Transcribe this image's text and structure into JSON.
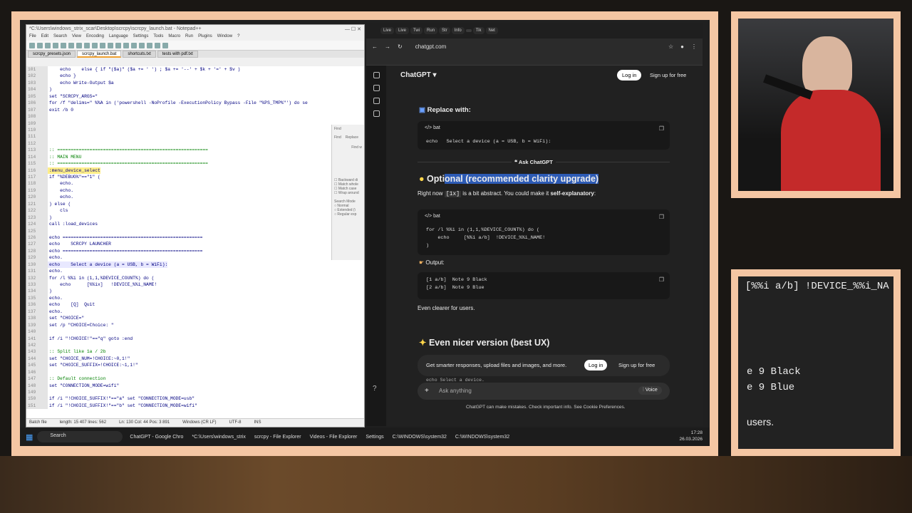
{
  "notepad": {
    "title": "*C:\\Users\\windows_strix_scar\\Desktop\\scrcpy\\scrcpy_launch.bat - Notepad++",
    "menu": [
      "File",
      "Edit",
      "Search",
      "View",
      "Encoding",
      "Language",
      "Settings",
      "Tools",
      "Macro",
      "Run",
      "Plugins",
      "Window",
      "?"
    ],
    "tabs": [
      "scrcpy_presets.json",
      "scrcpy_launch.bat",
      "shortcuts.txt",
      "tests with pdf.txt"
    ],
    "active_tab": 1,
    "lines": [
      {
        "n": "101",
        "t": "    echo    else { if \"($a)\" ($a += ' ') ; $a += '--' + $k + '=' + $v )"
      },
      {
        "n": "102",
        "t": "    echo }"
      },
      {
        "n": "103",
        "t": "    echo Write-Output $a"
      },
      {
        "n": "104",
        "t": ")"
      },
      {
        "n": "105",
        "t": "set \"SCRCPY_ARGS=\""
      },
      {
        "n": "106",
        "t": "for /f \"delims=\" %%A in ('powershell -NoProfile -ExecutionPolicy Bypass -File \"%PS_TMP%\"') do se"
      },
      {
        "n": "107",
        "t": "exit /b 0"
      },
      {
        "n": "108",
        "t": ""
      },
      {
        "n": "109",
        "t": ""
      },
      {
        "n": "110",
        "t": ""
      },
      {
        "n": "111",
        "t": ""
      },
      {
        "n": "112",
        "t": ""
      },
      {
        "n": "113",
        "t": ":: ========================================================"
      },
      {
        "n": "114",
        "t": ":: MAIN MENU"
      },
      {
        "n": "115",
        "t": ":: ========================================================"
      },
      {
        "n": "116",
        "t": ":menu_device_select"
      },
      {
        "n": "117",
        "t": "if \"%DEBUG%\"==\"1\" ("
      },
      {
        "n": "118",
        "t": "    echo."
      },
      {
        "n": "119",
        "t": "    echo."
      },
      {
        "n": "120",
        "t": "    echo."
      },
      {
        "n": "121",
        "t": ") else ("
      },
      {
        "n": "122",
        "t": "    cls"
      },
      {
        "n": "123",
        "t": ")"
      },
      {
        "n": "124",
        "t": "call :load_devices"
      },
      {
        "n": "125",
        "t": ""
      },
      {
        "n": "126",
        "t": "echo ===================================================="
      },
      {
        "n": "127",
        "t": "echo    SCRCPY LAUNCHER"
      },
      {
        "n": "128",
        "t": "echo ===================================================="
      },
      {
        "n": "129",
        "t": "echo."
      },
      {
        "n": "130",
        "t": "echo    Select a device (a = USB, b = WiFi):"
      },
      {
        "n": "131",
        "t": "echo."
      },
      {
        "n": "132",
        "t": "for /l %%i in (1,1,%DEVICE_COUNT%) do ("
      },
      {
        "n": "133",
        "t": "    echo      [%%ix]   !DEVICE_%%i_NAME!"
      },
      {
        "n": "134",
        "t": ")"
      },
      {
        "n": "135",
        "t": "echo."
      },
      {
        "n": "136",
        "t": "echo    [Q]  Quit"
      },
      {
        "n": "137",
        "t": "echo."
      },
      {
        "n": "138",
        "t": "set \"CHOICE=\""
      },
      {
        "n": "139",
        "t": "set /p \"CHOICE=Choice: \""
      },
      {
        "n": "140",
        "t": ""
      },
      {
        "n": "141",
        "t": "if /i \"!CHOICE!\"==\"q\" goto :end"
      },
      {
        "n": "142",
        "t": ""
      },
      {
        "n": "143",
        "t": ":: Split like 1a / 2b"
      },
      {
        "n": "144",
        "t": "set \"CHOICE_NUM=!CHOICE:~0,1!\""
      },
      {
        "n": "145",
        "t": "set \"CHOICE_SUFFIX=!CHOICE:~1,1!\""
      },
      {
        "n": "146",
        "t": ""
      },
      {
        "n": "147",
        "t": ":: Default connection"
      },
      {
        "n": "148",
        "t": "set \"CONNECTION_MODE=wifi\""
      },
      {
        "n": "149",
        "t": ""
      },
      {
        "n": "150",
        "t": "if /i \"!CHOICE_SUFFIX!\"==\"a\" set \"CONNECTION_MODE=usb\""
      },
      {
        "n": "151",
        "t": "if /i \"!CHOICE_SUFFIX!\"==\"b\" set \"CONNECTION_MODE=wifi\""
      }
    ],
    "find_panel": {
      "title": "Find",
      "find_label": "Find",
      "replace_tab": "Replace",
      "find_what": "Find w",
      "options": [
        "Backward di",
        "Match whole",
        "Match case",
        "Wrap around"
      ],
      "search_mode": "Search Mode",
      "modes": [
        "Normal",
        "Extended (\\",
        "Regular exp"
      ]
    },
    "status": {
      "type": "Batch file",
      "length": "length: 15 407   lines: 562",
      "pos": "Ln: 130   Col: 44   Pos: 3 891",
      "eol": "Windows (CR LF)",
      "enc": "UTF-8",
      "ins": "INS"
    }
  },
  "chrome": {
    "tabs": [
      "Live",
      "Live",
      "Twi",
      "Run",
      "Str",
      "Info",
      "",
      "Tik",
      "Net"
    ],
    "url": "chatgpt.com"
  },
  "chatgpt": {
    "brand": "ChatGPT",
    "login": "Log in",
    "signup": "Sign up for free",
    "replace_heading": "Replace with:",
    "code1_lang": "bat",
    "code1": "echo   Select a device (a = USB, b = WiFi):",
    "ask": "Ask ChatGPT",
    "optional_heading_a": "Opti",
    "optional_heading_b": "onal (recommended clarity upgrade)",
    "explain_a": "Right now",
    "explain_code": "[1x]",
    "explain_b": "is a bit abstract. You could make it",
    "explain_bold": "self-explanatory",
    "code2_lang": "bat",
    "code2": "for /l %%i in (1,1,%DEVICE_COUNT%) do (\n    echo     [%%i a/b]  !DEVICE_%%i_NAME!\n)",
    "output_heading": "Output:",
    "code3": "[1 a/b]  Note 9 Black\n[2 a/b]  Note 9 Blue",
    "clearer": "Even clearer for users.",
    "nicer_heading": "Even nicer version (best UX)",
    "banner": "Get smarter responses, upload files and images, and more.",
    "banner_login": "Log in",
    "banner_signup": "Sign up for free",
    "peek": "echo   Select a device.",
    "input_placeholder": "Ask anything",
    "voice": "Voice",
    "disclaimer": "ChatGPT can make mistakes. Check important info. See Cookie Preferences."
  },
  "taskbar": {
    "search": "Search",
    "items": [
      "ChatGPT - Google Chro",
      "*C:\\Users\\windows_strix",
      "scrcpy - File Explorer",
      "Videos - File Explorer",
      "Settings",
      "C:\\WINDOWS\\system32",
      "C:\\WINDOWS\\system32"
    ],
    "time": "17:28",
    "date": "26.03.2026"
  },
  "zoom": {
    "line1": "[%%i a/b]  !DEVICE_%%i_NA",
    "line2": "e 9 Black",
    "line3": "e 9 Blue",
    "line4": "users."
  }
}
